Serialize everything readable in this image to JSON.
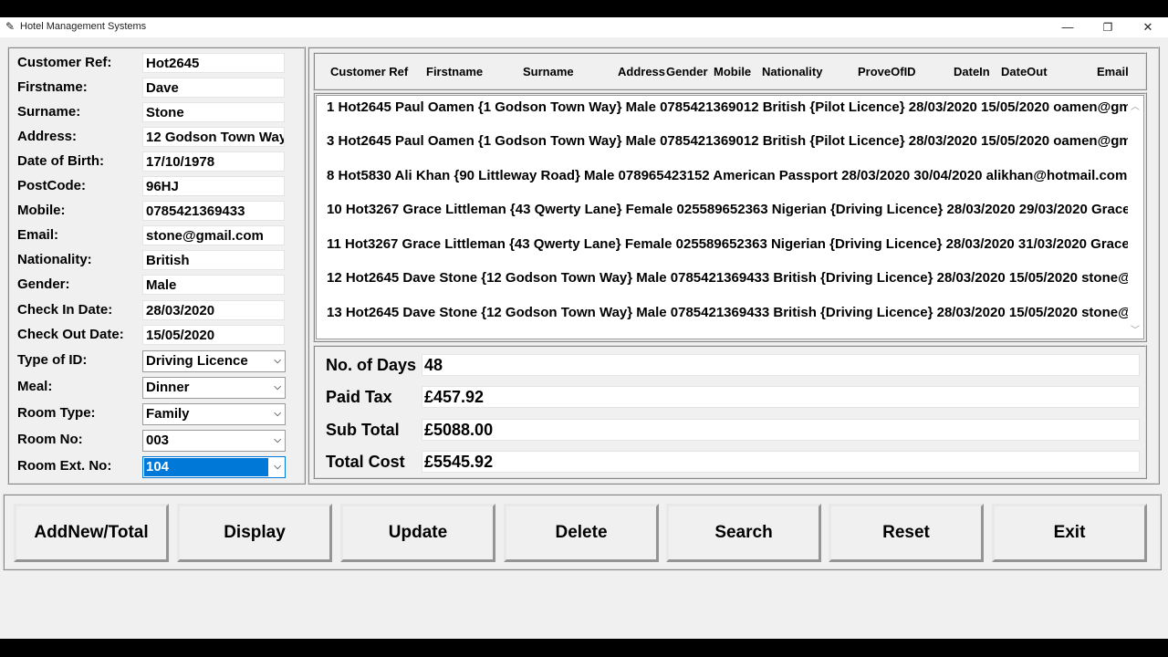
{
  "window": {
    "title": "Hotel Management Systems",
    "minimize": "—",
    "restore": "❐",
    "close": "✕"
  },
  "form": {
    "fields": [
      {
        "label": "Customer Ref:",
        "value": "Hot2645"
      },
      {
        "label": "Firstname:",
        "value": "Dave"
      },
      {
        "label": "Surname:",
        "value": "Stone"
      },
      {
        "label": "Address:",
        "value": "12 Godson Town Way"
      },
      {
        "label": "Date of Birth:",
        "value": "17/10/1978"
      },
      {
        "label": "PostCode:",
        "value": "96HJ"
      },
      {
        "label": "Mobile:",
        "value": "0785421369433"
      },
      {
        "label": "Email:",
        "value": "stone@gmail.com"
      },
      {
        "label": "Nationality:",
        "value": "British"
      },
      {
        "label": "Gender:",
        "value": "Male"
      },
      {
        "label": "Check In Date:",
        "value": "28/03/2020"
      },
      {
        "label": "Check Out Date:",
        "value": "15/05/2020"
      }
    ],
    "combos": [
      {
        "label": "Type of ID:",
        "value": "Driving Licence"
      },
      {
        "label": "Meal:",
        "value": "Dinner"
      },
      {
        "label": "Room Type:",
        "value": "Family"
      },
      {
        "label": "Room No:",
        "value": "003"
      },
      {
        "label": "Room Ext. No:",
        "value": "104"
      }
    ]
  },
  "table": {
    "headers": [
      "Customer Ref",
      "Firstname",
      "Surname",
      "Address",
      "Gender",
      "Mobile",
      "Nationality",
      "ProveOfID",
      "DateIn",
      "DateOut",
      "Email"
    ],
    "records": [
      "1 Hot2645 Paul Oamen {1 Godson Town Way} Male 0785421369012 British {Pilot Licence} 28/03/2020 15/05/2020 oamen@gmail.com",
      "3 Hot2645 Paul Oamen {1 Godson Town Way} Male 0785421369012 British {Pilot Licence} 28/03/2020 15/05/2020 oamen@gmail.com",
      "8 Hot5830 Ali Khan {90 Littleway Road} Male 078965423152 American Passport 28/03/2020 30/04/2020 alikhan@hotmail.com",
      "10 Hot3267 Grace Littleman {43 Qwerty Lane} Female 025589652363 Nigerian {Driving Licence} 28/03/2020 29/03/2020 Grace",
      "11 Hot3267 Grace Littleman {43 Qwerty Lane} Female 025589652363 Nigerian {Driving Licence} 28/03/2020 31/03/2020 Grace",
      "12 Hot2645 Dave Stone {12 Godson Town Way} Male 0785421369433 British {Driving Licence} 28/03/2020 15/05/2020 stone@gmail.com",
      "13 Hot2645 Dave Stone {12 Godson Town Way} Male 0785421369433 British {Driving Licence} 28/03/2020 15/05/2020 stone@gmail.com"
    ]
  },
  "totals": [
    {
      "label": "No. of Days",
      "value": "48"
    },
    {
      "label": "Paid Tax",
      "value": "£457.92"
    },
    {
      "label": "Sub Total",
      "value": "£5088.00"
    },
    {
      "label": "Total Cost",
      "value": "£5545.92"
    }
  ],
  "buttons": [
    "AddNew/Total",
    "Display",
    "Update",
    "Delete",
    "Search",
    "Reset",
    "Exit"
  ]
}
